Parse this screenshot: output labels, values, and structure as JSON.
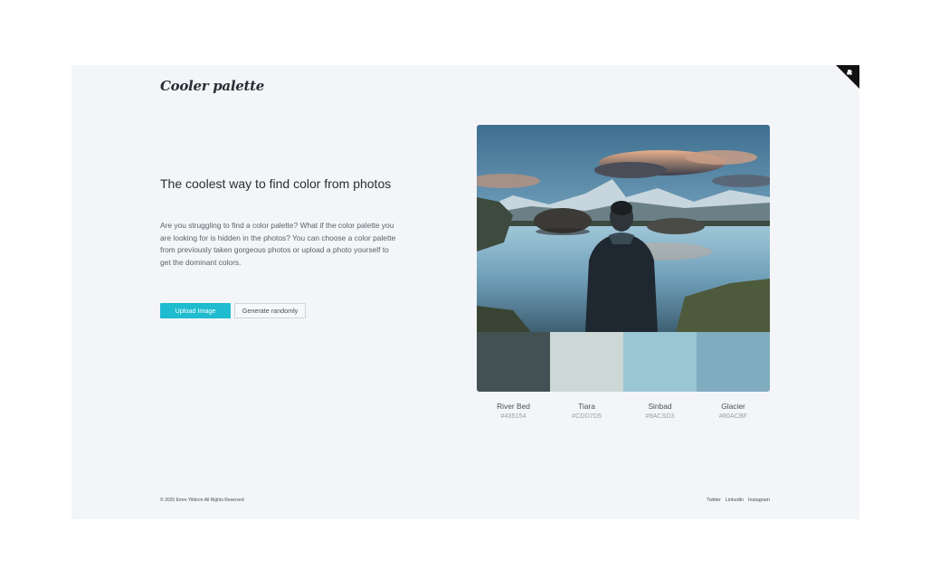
{
  "header": {
    "logo": "Cooler palette",
    "corner_icon": "github-corner-icon"
  },
  "hero": {
    "title": "The coolest way to find color from photos",
    "description": "Are you struggling to find a color palette? What if the color palette you are looking for is hidden in the photos? You can choose a color palette from previously taken gorgeous photos or upload a photo yourself to get the dominant colors.",
    "upload_label": "Upload Image",
    "random_label": "Generate randomly"
  },
  "palette": {
    "colors": [
      {
        "name": "River Bed",
        "hex": "#435154"
      },
      {
        "name": "Tiara",
        "hex": "#CDD7D5"
      },
      {
        "name": "Sinbad",
        "hex": "#9ACSD3"
      },
      {
        "name": "Glacier",
        "hex": "#80ACBF"
      }
    ],
    "swatch_colors": [
      "#435154",
      "#CDD7D5",
      "#9AC5D3",
      "#80ACBF"
    ]
  },
  "footer": {
    "copyright": "© 2020 Emre Yildırım All Rights Reserved",
    "links": [
      "Twitter",
      "Linkedin",
      "Instagram"
    ]
  },
  "colors": {
    "accent": "#1FBCD0",
    "background": "#F4F5F8",
    "text": "#2A2D35"
  }
}
